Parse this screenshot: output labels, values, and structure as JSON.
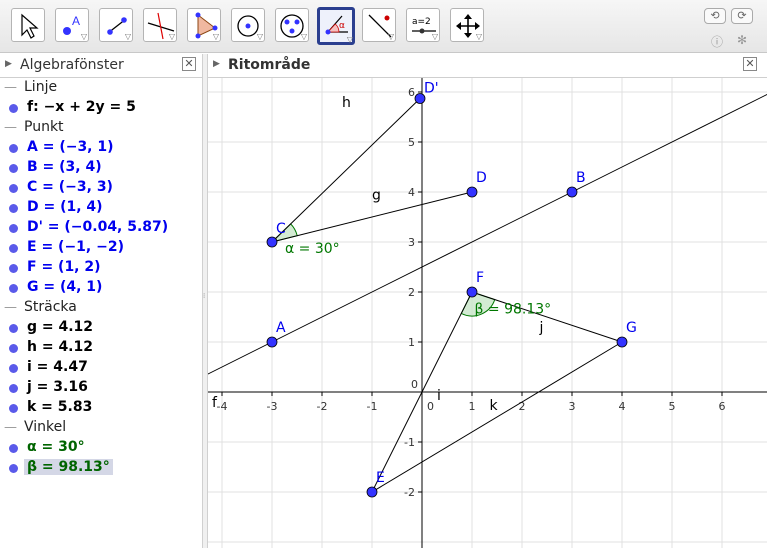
{
  "toolbar": {
    "tools": [
      {
        "name": "move-tool-icon",
        "label": ""
      },
      {
        "name": "point-tool-icon",
        "label": "A"
      },
      {
        "name": "line-tool-icon",
        "label": ""
      },
      {
        "name": "perpendicular-tool-icon",
        "label": ""
      },
      {
        "name": "polygon-tool-icon",
        "label": ""
      },
      {
        "name": "circle-tool-icon",
        "label": ""
      },
      {
        "name": "conic-tool-icon",
        "label": ""
      },
      {
        "name": "angle-tool-icon",
        "label": "α"
      },
      {
        "name": "reflect-tool-icon",
        "label": ""
      },
      {
        "name": "slider-tool-icon",
        "label": "a=2"
      },
      {
        "name": "move-view-tool-icon",
        "label": ""
      }
    ],
    "active_tool": "angle-tool-icon",
    "undo_icon": "undo-icon",
    "redo_icon": "redo-icon",
    "help_icon": "help-icon",
    "settings_icon": "gear-icon"
  },
  "algebra": {
    "title": "Algebrafönster",
    "categories": [
      {
        "label": "Linje",
        "items": [
          {
            "text": "f: −x + 2y = 5",
            "color": "black"
          }
        ]
      },
      {
        "label": "Punkt",
        "items": [
          {
            "text": "A = (−3, 1)",
            "color": "blue"
          },
          {
            "text": "B = (3, 4)",
            "color": "blue"
          },
          {
            "text": "C = (−3, 3)",
            "color": "blue"
          },
          {
            "text": "D = (1, 4)",
            "color": "blue"
          },
          {
            "text": "D' = (−0.04, 5.87)",
            "color": "blue"
          },
          {
            "text": "E = (−1, −2)",
            "color": "blue"
          },
          {
            "text": "F = (1, 2)",
            "color": "blue"
          },
          {
            "text": "G = (4, 1)",
            "color": "blue"
          }
        ]
      },
      {
        "label": "Sträcka",
        "items": [
          {
            "text": "g = 4.12",
            "color": "black"
          },
          {
            "text": "h = 4.12",
            "color": "black"
          },
          {
            "text": "i = 4.47",
            "color": "black"
          },
          {
            "text": "j = 3.16",
            "color": "black"
          },
          {
            "text": "k = 5.83",
            "color": "black"
          }
        ]
      },
      {
        "label": "Vinkel",
        "items": [
          {
            "text": "α = 30°",
            "color": "green"
          },
          {
            "text": "β = 98.13°",
            "color": "green",
            "selected": true
          }
        ]
      }
    ]
  },
  "graphics": {
    "title": "Ritområde",
    "x_ticks": [
      "-4",
      "-3",
      "-2",
      "-1",
      "0",
      "1",
      "2",
      "3",
      "4",
      "5",
      "6"
    ],
    "y_ticks": [
      "-2",
      "-1",
      "1",
      "2",
      "3",
      "4",
      "5",
      "6"
    ],
    "points": [
      {
        "label": "A",
        "x": -3,
        "y": 1
      },
      {
        "label": "B",
        "x": 3,
        "y": 4
      },
      {
        "label": "C",
        "x": -3,
        "y": 3
      },
      {
        "label": "D",
        "x": 1,
        "y": 4
      },
      {
        "label": "D'",
        "x": -0.04,
        "y": 5.87
      },
      {
        "label": "E",
        "x": -1,
        "y": -2
      },
      {
        "label": "F",
        "x": 1,
        "y": 2
      },
      {
        "label": "G",
        "x": 4,
        "y": 1
      }
    ],
    "segments": [
      {
        "label": "g",
        "from": "C",
        "to": "D"
      },
      {
        "label": "h",
        "from": "C",
        "to": "D'"
      },
      {
        "label": "i",
        "from": "E",
        "to": "F"
      },
      {
        "label": "j",
        "from": "F",
        "to": "G"
      },
      {
        "label": "k",
        "from": "E",
        "to": "G"
      }
    ],
    "line_label": "f",
    "angles": [
      {
        "label": "α = 30°",
        "vertex": "C"
      },
      {
        "label": "β = 98.13°",
        "vertex": "F"
      }
    ],
    "colors": {
      "point": "#3333ff",
      "angle": "#007700",
      "angle_fill": "#c8e6c8",
      "grid": "#e0e0e0"
    }
  }
}
